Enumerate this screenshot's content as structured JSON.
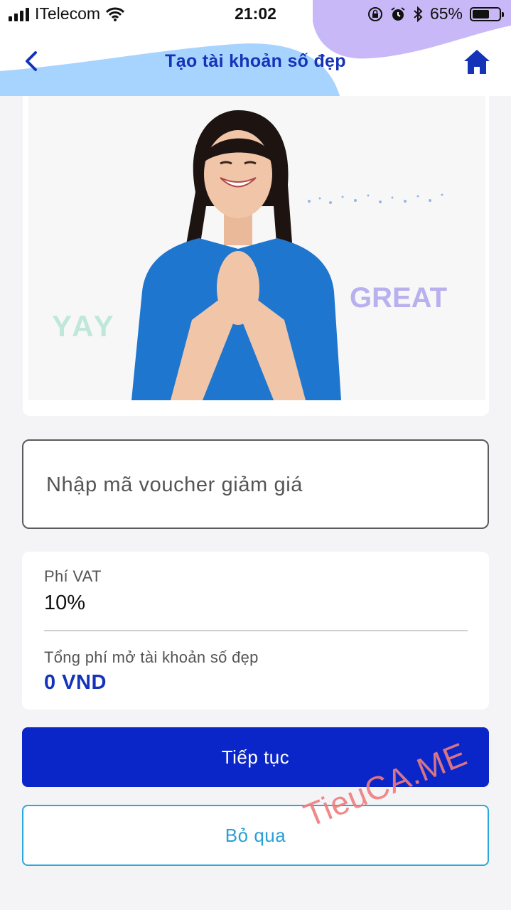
{
  "status_bar": {
    "carrier": "ITelecom",
    "time": "21:02",
    "battery_percent": "65%",
    "battery_level": 0.65
  },
  "header": {
    "title": "Tạo tài khoản số đẹp",
    "back_icon": "chevron-left-icon",
    "home_icon": "home-icon",
    "colors": {
      "blue_shape": "#a7d3ff",
      "purple_shape": "#c9b8f7",
      "title": "#1433b8"
    }
  },
  "hero": {
    "word_left": "YAY",
    "word_right": "GREAT"
  },
  "voucher": {
    "placeholder": "Nhập mã voucher giảm giá",
    "value": ""
  },
  "fees": {
    "vat_label": "Phí VAT",
    "vat_value": "10%",
    "total_label": "Tổng phí mở tài khoản số đẹp",
    "total_value": "0 VND"
  },
  "actions": {
    "continue_label": "Tiếp tục",
    "skip_label": "Bỏ qua",
    "continue_color": "#0b26c8",
    "skip_color": "#2aa7de"
  },
  "watermark": "TieuCA.ME"
}
